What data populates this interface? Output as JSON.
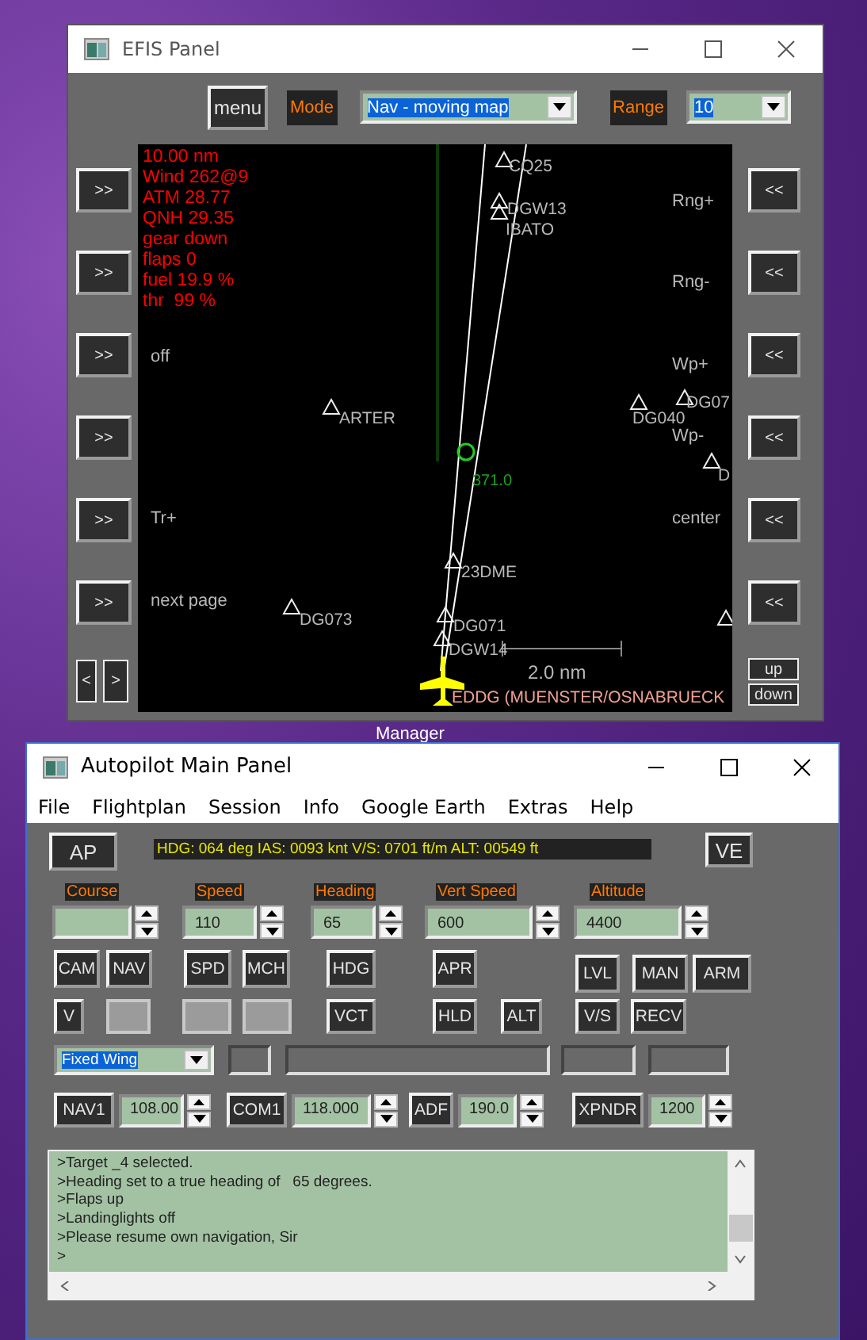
{
  "desktop": {
    "label": "Manager"
  },
  "efis": {
    "title": "EFIS Panel",
    "menu_button": "menu",
    "mode_label": "Mode",
    "mode_value": "Nav - moving map",
    "range_label": "Range",
    "range_value": "10",
    "left_buttons": [
      ">>",
      ">>",
      ">>",
      ">>",
      ">>",
      ">>"
    ],
    "page_buttons": [
      "<",
      ">"
    ],
    "right_buttons": [
      "<<",
      "<<",
      "<<",
      "<<",
      "<<",
      "<<"
    ],
    "scroll_buttons": [
      "up",
      "down"
    ],
    "status_lines": [
      "10.00 nm",
      "Wind 262@9",
      "ATM 28.77",
      "QNH 29.35",
      "gear down",
      "flaps 0",
      "fuel 19.9 %",
      "thr  99 %"
    ],
    "left_map_labels": [
      "off",
      "Tr+",
      "next page"
    ],
    "right_map_labels": [
      "Rng+",
      "Rng-",
      "Wp+",
      "Wp-",
      "center"
    ],
    "waypoints": [
      {
        "kind": "labeled",
        "name": "CQ25"
      },
      {
        "kind": "marker"
      },
      {
        "kind": "labeled",
        "name": "DGW13"
      },
      {
        "kind": "text",
        "name": "IBATO"
      },
      {
        "kind": "labeled",
        "name": "ARTER"
      },
      {
        "kind": "labeled",
        "name": "DG040"
      },
      {
        "kind": "labeled",
        "name": "DG07"
      },
      {
        "kind": "labeled",
        "name": "D"
      },
      {
        "kind": "labeled",
        "name": "23DME"
      },
      {
        "kind": "labeled",
        "name": "DG073"
      },
      {
        "kind": "labeled",
        "name": "DG071"
      },
      {
        "kind": "labeled",
        "name": "DGW14"
      },
      {
        "kind": "marker"
      }
    ],
    "station": {
      "frequency": "371.0"
    },
    "scale": "2.0 nm",
    "airport": "EDDG (MUENSTER/OSNABRUECK"
  },
  "autopilot": {
    "title": "Autopilot Main Panel",
    "menu": [
      "File",
      "Flightplan",
      "Session",
      "Info",
      "Google Earth",
      "Extras",
      "Help"
    ],
    "ap_button": "AP",
    "status": "HDG: 064 deg IAS: 0093 knt V/S: 0701 ft/m ALT: 00549 ft",
    "ve_button": "VE",
    "settings": [
      {
        "label": "Course"
      },
      {
        "label": "Speed",
        "value": "110"
      },
      {
        "label": "Heading",
        "value": "65"
      },
      {
        "label": "Vert Speed",
        "value": "600"
      },
      {
        "label": "Altitude",
        "value": "4400"
      }
    ],
    "buttons_row1": [
      {
        "kind": "button",
        "label": "CAM"
      },
      {
        "kind": "button",
        "label": "NAV"
      },
      {
        "kind": "button",
        "label": "SPD"
      },
      {
        "kind": "button",
        "label": "MCH"
      },
      {
        "kind": "button",
        "label": "HDG"
      },
      {
        "kind": "button",
        "label": "APR"
      },
      {
        "kind": "button",
        "label": "LVL"
      },
      {
        "kind": "button",
        "label": "MAN"
      },
      {
        "kind": "button",
        "label": "ARM"
      }
    ],
    "buttons_row2": [
      {
        "kind": "button",
        "label": "V"
      },
      {
        "kind": "blank"
      },
      {
        "kind": "blank"
      },
      {
        "kind": "blank"
      },
      {
        "kind": "button",
        "label": "VCT"
      },
      {
        "kind": "button",
        "label": "HLD"
      },
      {
        "kind": "button",
        "label": "ALT"
      },
      {
        "kind": "button",
        "label": "V/S"
      },
      {
        "kind": "button",
        "label": "RECV"
      }
    ],
    "aircraft_type": "Fixed Wing",
    "radios": [
      {
        "label": "NAV1",
        "value": "108.00"
      },
      {
        "label": "COM1",
        "value": "118.000"
      },
      {
        "label": "ADF",
        "value": "190.0"
      },
      {
        "label": "XPNDR",
        "value": "1200"
      }
    ],
    "console_lines": [
      ">Target _4 selected.",
      ">Heading set to a true heading of   65 degrees.",
      ">Flaps up",
      ">Landinglights off",
      ">Please resume own navigation, Sir",
      ">"
    ]
  }
}
